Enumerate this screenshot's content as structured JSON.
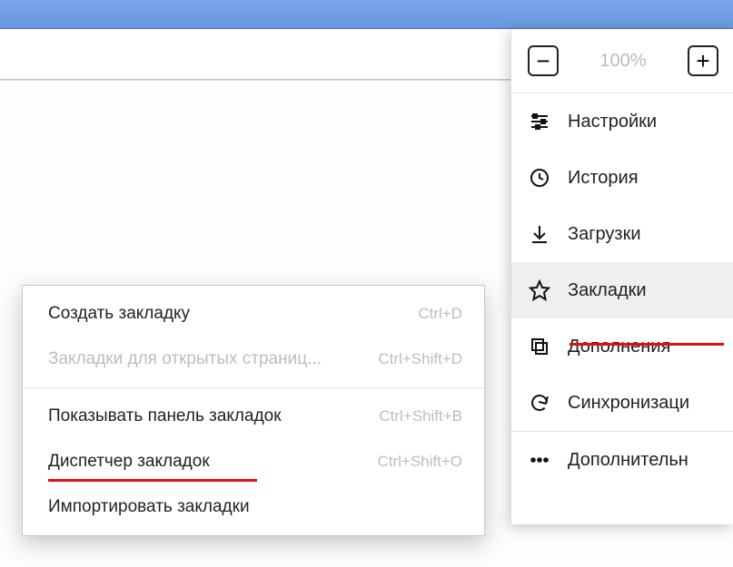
{
  "zoom": {
    "minus": "−",
    "value": "100%",
    "plus": "+"
  },
  "menu": {
    "settings": "Настройки",
    "history": "История",
    "downloads": "Загрузки",
    "bookmarks": "Закладки",
    "addons": "Дополнения",
    "sync": "Синхронизаци",
    "more": "Дополнительн"
  },
  "sub": {
    "create": {
      "label": "Создать закладку",
      "shortcut": "Ctrl+D"
    },
    "open_tabs": {
      "label": "Закладки для открытых страниц...",
      "shortcut": "Ctrl+Shift+D"
    },
    "show_bar": {
      "label": "Показывать панель закладок",
      "shortcut": "Ctrl+Shift+B"
    },
    "manager": {
      "label": "Диспетчер закладок",
      "shortcut": "Ctrl+Shift+O"
    },
    "import": {
      "label": "Импортировать закладки",
      "shortcut": ""
    }
  }
}
